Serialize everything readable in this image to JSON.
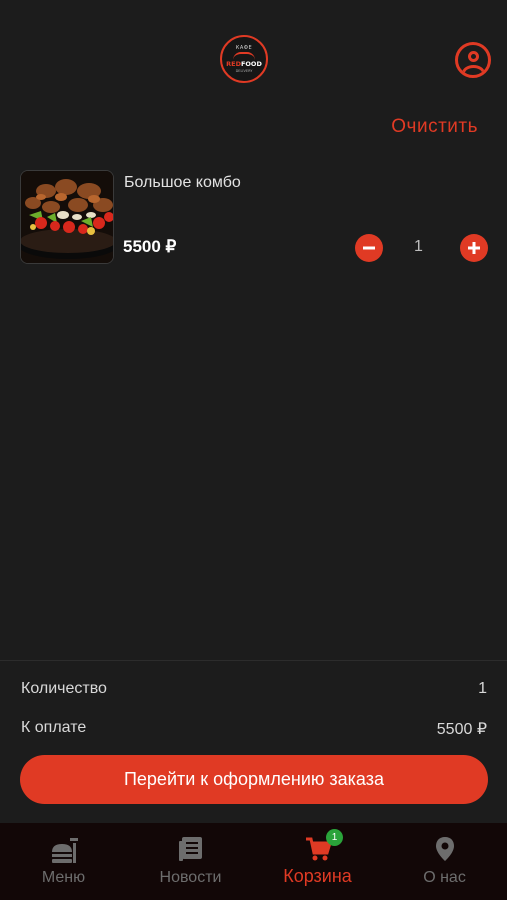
{
  "header": {
    "logo": {
      "top_text": "КАФЕ",
      "brand_red": "RED",
      "brand_white": "FOOD",
      "sub_text": "DELIVERY"
    },
    "profile_icon": "user-circle-icon"
  },
  "cart": {
    "clear_label": "Очистить",
    "items": [
      {
        "name": "Большое комбо",
        "price": "5500 ₽",
        "quantity": "1",
        "image": "grilled-meat-vegetables-photo"
      }
    ]
  },
  "summary": {
    "quantity_label": "Количество",
    "quantity_value": "1",
    "total_label": "К оплате",
    "total_value": "5500 ₽",
    "checkout_label": "Перейти к оформлению заказа"
  },
  "tabbar": {
    "active": "cart",
    "tabs": [
      {
        "id": "menu",
        "label": "Меню",
        "icon": "fastfood-icon"
      },
      {
        "id": "news",
        "label": "Новости",
        "icon": "newspaper-icon"
      },
      {
        "id": "cart",
        "label": "Корзина",
        "icon": "cart-icon",
        "badge": "1"
      },
      {
        "id": "about",
        "label": "О нас",
        "icon": "location-pin-icon"
      }
    ]
  },
  "colors": {
    "accent": "#e03a24",
    "background": "#1c1c1c",
    "tabbar": "#120707",
    "badge": "#2aa33a"
  }
}
